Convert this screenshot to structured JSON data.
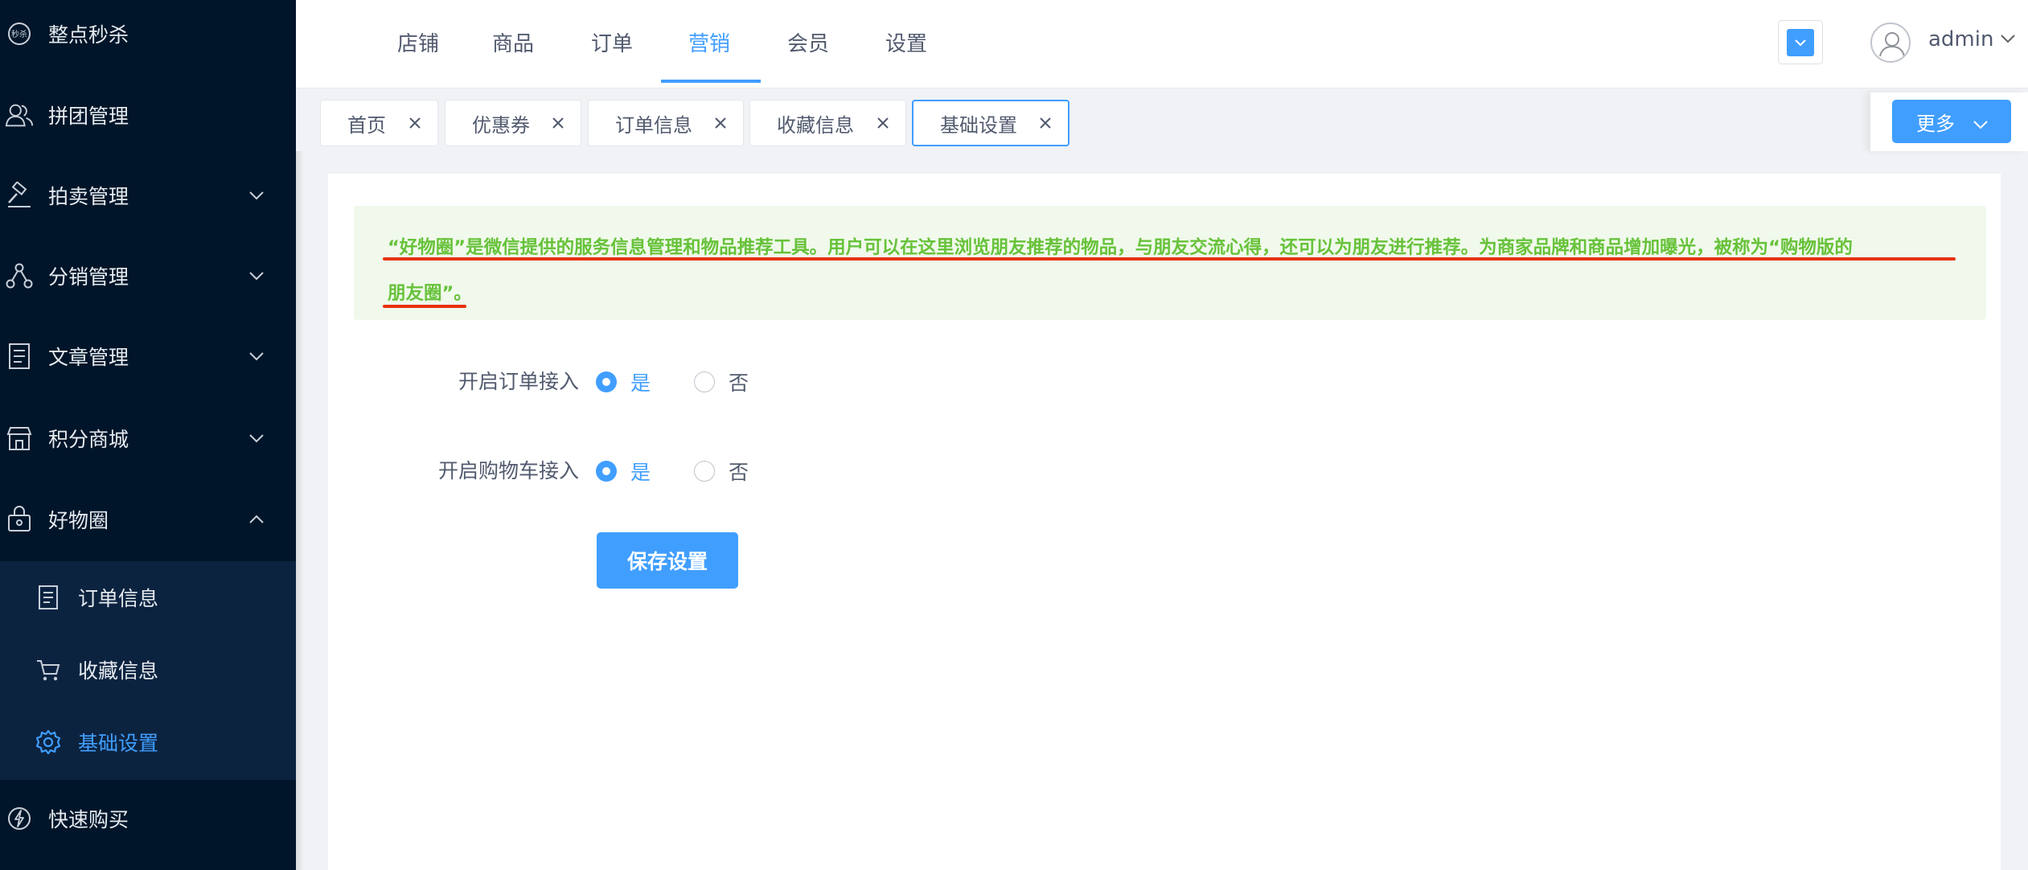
{
  "sidebar": {
    "items": [
      {
        "label": "整点秒杀",
        "icon": "flash-sale-icon",
        "expandable": false
      },
      {
        "label": "拼团管理",
        "icon": "group-buy-icon",
        "expandable": false
      },
      {
        "label": "拍卖管理",
        "icon": "gavel-icon",
        "expandable": true
      },
      {
        "label": "分销管理",
        "icon": "distribution-icon",
        "expandable": true
      },
      {
        "label": "文章管理",
        "icon": "article-icon",
        "expandable": true
      },
      {
        "label": "积分商城",
        "icon": "shop-icon",
        "expandable": true
      },
      {
        "label": "好物圈",
        "icon": "goods-circle-icon",
        "expandable": true,
        "expanded": true
      },
      {
        "label": "快速购买",
        "icon": "quick-buy-icon",
        "expandable": false
      }
    ],
    "submenu": [
      {
        "label": "订单信息",
        "icon": "document-icon"
      },
      {
        "label": "收藏信息",
        "icon": "cart-icon"
      },
      {
        "label": "基础设置",
        "icon": "gear-icon",
        "active": true
      }
    ],
    "accent": "#409eff",
    "background": "#001529"
  },
  "header": {
    "nav": [
      "店铺",
      "商品",
      "订单",
      "营销",
      "会员",
      "设置"
    ],
    "active_nav": "营销",
    "username": "admin"
  },
  "tags": {
    "items": [
      "首页",
      "优惠券",
      "订单信息",
      "收藏信息",
      "基础设置"
    ],
    "active": "基础设置",
    "more_label": "更多"
  },
  "notice": {
    "line1": "“好物圈”是微信提供的服务信息管理和物品推荐工具。用户可以在这里浏览朋友推荐的物品，与朋友交流心得，还可以为朋友进行推荐。为商家品牌和商品增加曝光，被称为“购物版的",
    "line2": "朋友圈”。",
    "color": "#67c23a"
  },
  "form": {
    "order_access": {
      "label": "开启订单接入",
      "yes": "是",
      "no": "否",
      "value": "是"
    },
    "cart_access": {
      "label": "开启购物车接入",
      "yes": "是",
      "no": "否",
      "value": "是"
    },
    "save_label": "保存设置"
  }
}
